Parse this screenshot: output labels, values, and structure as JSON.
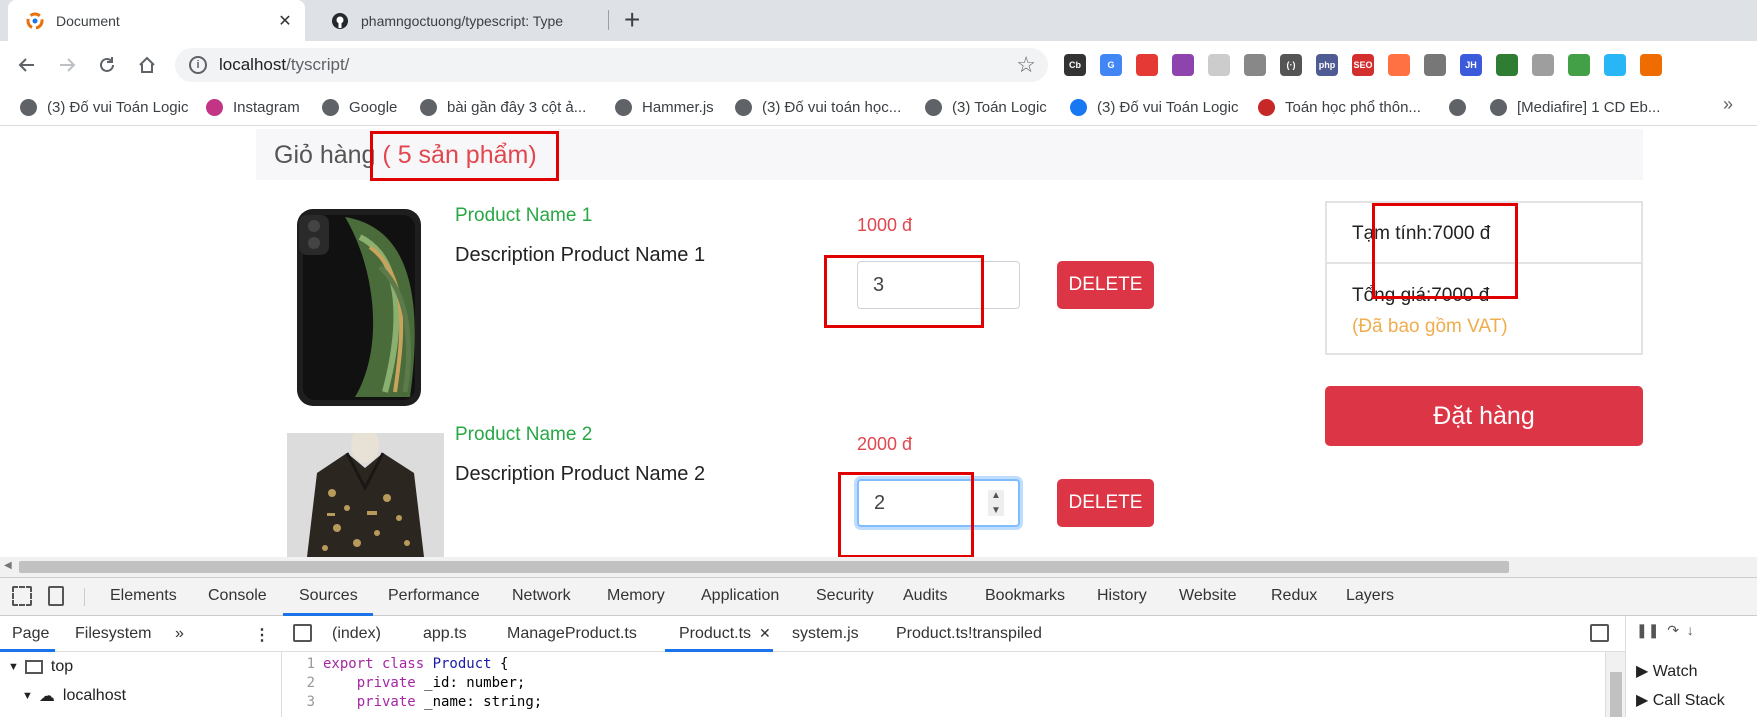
{
  "browser": {
    "tabs": [
      {
        "title": "Document",
        "active": true
      },
      {
        "title": "phamngoctuong/typescript: Type",
        "active": false
      }
    ],
    "close_glyph": "✕",
    "new_tab_glyph": "+",
    "url_host": "localhost",
    "url_path": "/tyscript/",
    "extensions": [
      {
        "label": "Cb",
        "color": "#333333"
      },
      {
        "label": "G",
        "color": "#4285f4"
      },
      {
        "label": "",
        "color": "#e53935"
      },
      {
        "label": "",
        "color": "#8e44ad"
      },
      {
        "label": "",
        "color": "#cccccc"
      },
      {
        "label": "",
        "color": "#888888"
      },
      {
        "label": "(·)",
        "color": "#555555"
      },
      {
        "label": "php",
        "color": "#4f5b93"
      },
      {
        "label": "SEO",
        "color": "#d32f2f"
      },
      {
        "label": "",
        "color": "#ff7043"
      },
      {
        "label": "",
        "color": "#777777"
      },
      {
        "label": "JH",
        "color": "#3b5bdb"
      },
      {
        "label": "",
        "color": "#2e7d32"
      },
      {
        "label": "",
        "color": "#9e9e9e"
      },
      {
        "label": "",
        "color": "#43a047"
      },
      {
        "label": "",
        "color": "#29b6f6"
      },
      {
        "label": "",
        "color": "#ef6c00"
      }
    ],
    "bookmarks": [
      {
        "label": "(3) Đố vui Toán Logic",
        "icon": "globe-icon",
        "color": "#5f6368"
      },
      {
        "label": "Instagram",
        "icon": "instagram-icon",
        "color": "#c13584"
      },
      {
        "label": "Google",
        "icon": "globe-icon",
        "color": "#5f6368"
      },
      {
        "label": "bài gần đây 3 cột ả...",
        "icon": "globe-icon",
        "color": "#5f6368"
      },
      {
        "label": "Hammer.js",
        "icon": "globe-icon",
        "color": "#5f6368"
      },
      {
        "label": "(3) Đố vui toán học...",
        "icon": "globe-icon",
        "color": "#5f6368"
      },
      {
        "label": "(3) Toán Logic",
        "icon": "globe-icon",
        "color": "#5f6368"
      },
      {
        "label": "(3) Đố vui Toán Logic",
        "icon": "facebook-icon",
        "color": "#1877f2"
      },
      {
        "label": "Toán học phổ thôn...",
        "icon": "site-icon",
        "color": "#c62828"
      },
      {
        "label": "",
        "icon": "globe-icon",
        "color": "#5f6368"
      },
      {
        "label": "[Mediafire] 1 CD Eb...",
        "icon": "globe-icon",
        "color": "#5f6368"
      }
    ],
    "bookmarks_more": "»"
  },
  "cart": {
    "title": "Giỏ hàng",
    "count_text": "( 5 sản phẩm)",
    "products": [
      {
        "name": "Product Name 1",
        "description": "Description Product Name 1",
        "price": "1000 đ",
        "quantity": "3",
        "delete_label": "DELETE"
      },
      {
        "name": "Product Name 2",
        "description": "Description Product Name 2",
        "price": "2000 đ",
        "quantity": "2",
        "delete_label": "DELETE"
      }
    ],
    "summary": {
      "subtotal": "Tạm tính:7000 đ",
      "total": "Tổng giá:7000 đ",
      "vat_note": "(Đã bao gồm VAT)"
    },
    "order_label": "Đặt hàng"
  },
  "devtools": {
    "tabs": [
      "Elements",
      "Console",
      "Sources",
      "Performance",
      "Network",
      "Memory",
      "Application",
      "Security",
      "Audits",
      "Bookmarks",
      "History",
      "Website",
      "Redux",
      "Layers"
    ],
    "active_tab": "Sources",
    "nav_tabs": [
      "Page",
      "Filesystem"
    ],
    "nav_more": "»",
    "files": [
      "(index)",
      "app.ts",
      "ManageProduct.ts",
      "Product.ts",
      "system.js",
      "Product.ts!transpiled"
    ],
    "active_file": "Product.ts",
    "tree": [
      "top",
      "localhost"
    ],
    "code_lines": [
      {
        "n": "1",
        "kw": "export class ",
        "ty": "Product",
        "rest": " {"
      },
      {
        "n": "2",
        "kw": "    private ",
        "ty": "_id",
        "rest": ": number;"
      },
      {
        "n": "3",
        "kw": "    private ",
        "ty": "_name",
        "rest": ": string;"
      }
    ],
    "right_items": [
      "Watch",
      "Call Stack"
    ]
  }
}
